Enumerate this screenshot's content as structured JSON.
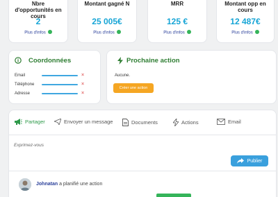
{
  "kpis": [
    {
      "title": "Nbre d'opportunités en cours",
      "value": "2",
      "link": "Plus d'infos"
    },
    {
      "title": "Montant gagné N",
      "value": "25 005€",
      "link": "Plus d'infos"
    },
    {
      "title": "MRR",
      "value": "125 €",
      "link": "Plus d'infos"
    },
    {
      "title": "Montant opp en cours",
      "value": "12 487€",
      "link": "Plus d'infos"
    }
  ],
  "coordonnees": {
    "title": "Coordonnées",
    "fields": [
      {
        "label": "Email"
      },
      {
        "label": "Téléphone"
      },
      {
        "label": "Adresse"
      }
    ],
    "remove_symbol": "×"
  },
  "prochaine_action": {
    "title": "Prochaine action",
    "status": "Aucune.",
    "create_button": "Créer une action"
  },
  "activity": {
    "tabs": [
      {
        "label": "Partager",
        "icon": "megaphone-icon",
        "active": true
      },
      {
        "label": "Envoyer un message",
        "icon": "send-icon"
      },
      {
        "label": "Documents",
        "icon": "document-icon"
      },
      {
        "label": "Actions",
        "icon": "bolt-icon"
      },
      {
        "label": "Email",
        "icon": "envelope-icon"
      }
    ],
    "composer_placeholder": "Exprimez-vous",
    "publish_button": "Publier",
    "feed": [
      {
        "user": "Johnatan",
        "text": " a planifié une action"
      }
    ]
  },
  "colors": {
    "accent_blue": "#16a5d6",
    "green": "#35b45a",
    "orange": "#f5a623",
    "publish_blue": "#3aa0dd"
  }
}
